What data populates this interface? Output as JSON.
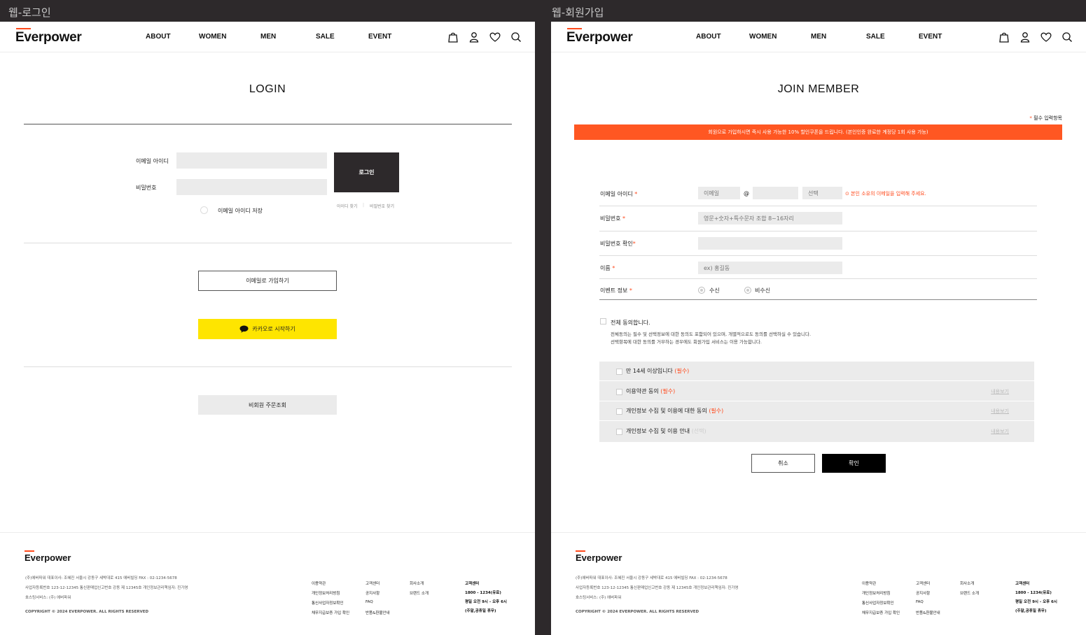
{
  "frames": {
    "login_label": "웹-로그인",
    "join_label": "웹-회원가입"
  },
  "header": {
    "logo": "Everpower",
    "nav": [
      "ABOUT",
      "WOMEN",
      "MEN",
      "SALE",
      "EVENT"
    ],
    "icons": [
      "bag-icon",
      "user-icon",
      "heart-icon",
      "search-icon"
    ]
  },
  "login": {
    "title": "LOGIN",
    "email_label": "이메일 아이디",
    "password_label": "비밀번호",
    "login_button": "로그인",
    "save_email": "이메일 아이디 저장",
    "find_id": "아이디 찾기",
    "find_password": "비밀번호 찾기",
    "separator": "|",
    "email_signup": "이메일로 가입하기",
    "kakao_start": "카카오로 시작하기",
    "guest_order": "비회원 주문조회"
  },
  "join": {
    "title": "JOIN MEMBER",
    "required_note": "필수 입력항목",
    "required_mark": "*",
    "banner": "회원으로 가입하시면 즉시 사용 가능한 10% 할인쿠폰을 드립니다. (본인인증 완료한 계정당 1회 사용 가능)",
    "email_label": "이메일 아이디",
    "email_placeholder": "이메일",
    "at": "@",
    "domain_select": "선택",
    "email_hint": "⊙ 본인 소유의 이메일을 입력해 주세요.",
    "password_label": "비밀번호",
    "password_placeholder": "영문+숫자+특수문자 조합 8~16자리",
    "password_confirm_label": "비밀번호 확인",
    "name_label": "이름",
    "name_placeholder": "ex) 홍길동",
    "event_label": "이벤트 정보",
    "event_receive": "수신",
    "event_refuse": "비수신",
    "agree_all": "전체 동의합니다.",
    "agree_desc_1": "전체동의는 필수 및 선택정보에 대한 동의도 포함되어 있으며, 개별적으로도 동의를 선택하실 수 있습니다.",
    "agree_desc_2": "선택항목에 대한 동의를 거부하는 경우에도 회원가입 서비스는 이용 가능합니다.",
    "agreements": [
      {
        "text": "만 14세 이상입니다",
        "tag": "(필수)",
        "required": true,
        "view": ""
      },
      {
        "text": "이용약관 동의",
        "tag": "(필수)",
        "required": true,
        "view": "내용보기"
      },
      {
        "text": "개인정보 수집 및 이용에 대한 동의",
        "tag": "(필수)",
        "required": true,
        "view": "내용보기"
      },
      {
        "text": "개인정보 수집 및 이용 안내",
        "tag": "(선택)",
        "required": false,
        "view": "내용보기"
      }
    ],
    "cancel": "취소",
    "confirm": "확인"
  },
  "footer": {
    "logo": "Everpower",
    "line1": "(주)에버파워     대표이사: 조혜진     서울시 강동구 세박대로 415 에버빌딩     FAX : 02-1234-5678",
    "line2": "사업자등록번호 123-12-12345     통신판매업신고번호 강동 제 12345호     개인정보관리책임자: 진가영",
    "line3": "호스팅서비스: (주) 에버파워",
    "copyright": "COPYRIGHT © 2024 EVERPOWER. ALL RIGHTS RESERVED",
    "col1": [
      "이용약관",
      "개인정보처리방침",
      "통신사업자정보확인",
      "채무지급보증 가입 확인"
    ],
    "col2": [
      "고객센터",
      "공지사항",
      "FAQ",
      "반품&환불안내"
    ],
    "col3": [
      "회사소개",
      "브랜드 소개"
    ],
    "col4": [
      "고객센터",
      "1800 - 1234(유료)",
      "평일 오전 9시 - 오후 6시",
      "(주말,공휴일 휴무)"
    ]
  },
  "colors": {
    "accent": "#ff5722",
    "kakao": "#fee500",
    "dark": "#2d292b"
  }
}
